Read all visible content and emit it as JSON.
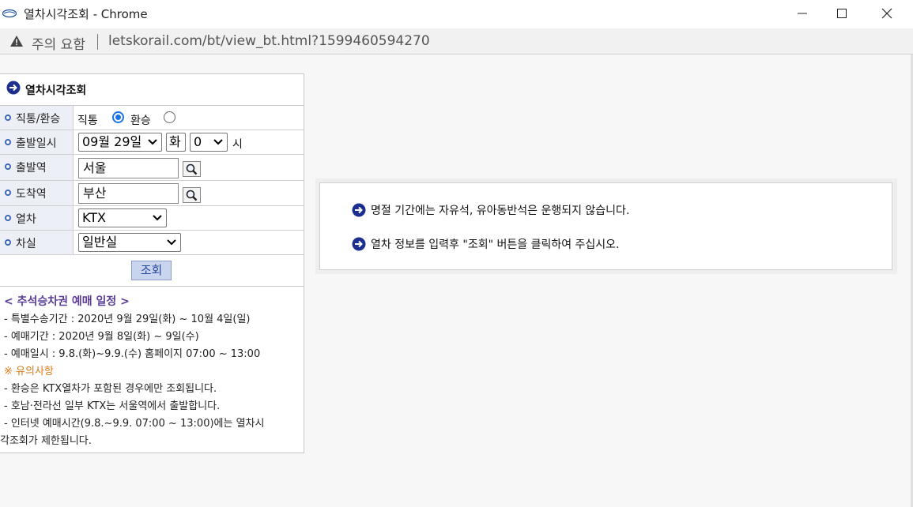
{
  "window": {
    "title": "열차시각조회 - Chrome",
    "warning_text": "주의 요함",
    "url": "letskorail.com/bt/view_bt.html?1599460594270"
  },
  "panel": {
    "title": "열차시각조회",
    "rows": {
      "type": {
        "label": "직통/환승",
        "option_direct": "직통",
        "option_transfer": "환승",
        "selected": "직통"
      },
      "departure_datetime": {
        "label": "출발일시",
        "date_value": "09월 29일",
        "weekday": "화",
        "hour_value": "0",
        "hour_unit": "시"
      },
      "departure_station": {
        "label": "출발역",
        "value": "서울"
      },
      "arrival_station": {
        "label": "도착역",
        "value": "부산"
      },
      "train": {
        "label": "열차",
        "value": "KTX"
      },
      "seat_class": {
        "label": "차실",
        "value": "일반실"
      }
    },
    "submit_label": "조회"
  },
  "notice": {
    "title": "< 추석승차권 예매 일정 >",
    "lines": [
      "- 특별수송기간 : 2020년 9월 29일(화) ~ 10월 4일(일)",
      "- 예매기간 : 2020년 9월 8일(화) ~ 9일(수)",
      "- 예매일시 : 9.8.(화)~9.9.(수) 홈페이지 07:00 ~ 13:00"
    ],
    "caution_title": "※ 유의사항",
    "caution_lines": [
      "- 환승은 KTX열차가 포함된 경우에만 조회됩니다.",
      "- 호남·전라선 일부 KTX는 서울역에서 출발합니다.",
      "- 인터넷 예매시간(9.8.~9.9. 07:00 ~ 13:00)에는 열차시",
      "각조회가 제한됩니다."
    ]
  },
  "info": {
    "lines": [
      "명절 기간에는 자유석, 유아동반석은 운행되지 않습니다.",
      "열차 정보를 입력후 \"조회\" 버튼을 클릭하여 주십시오."
    ]
  },
  "colors": {
    "accent_blue": "#1a73e8",
    "icon_navy": "#1c2f8f",
    "notice_purple": "#5c3c96",
    "caution_orange": "#d97b1a",
    "label_bg": "#eceff6",
    "submit_bg": "#c9d4ee"
  },
  "icons": {
    "title_icon": "korail-logo-icon",
    "warning": "warning-triangle-icon",
    "header_bullet": "arrow-circle-icon",
    "search": "magnifier-icon"
  }
}
